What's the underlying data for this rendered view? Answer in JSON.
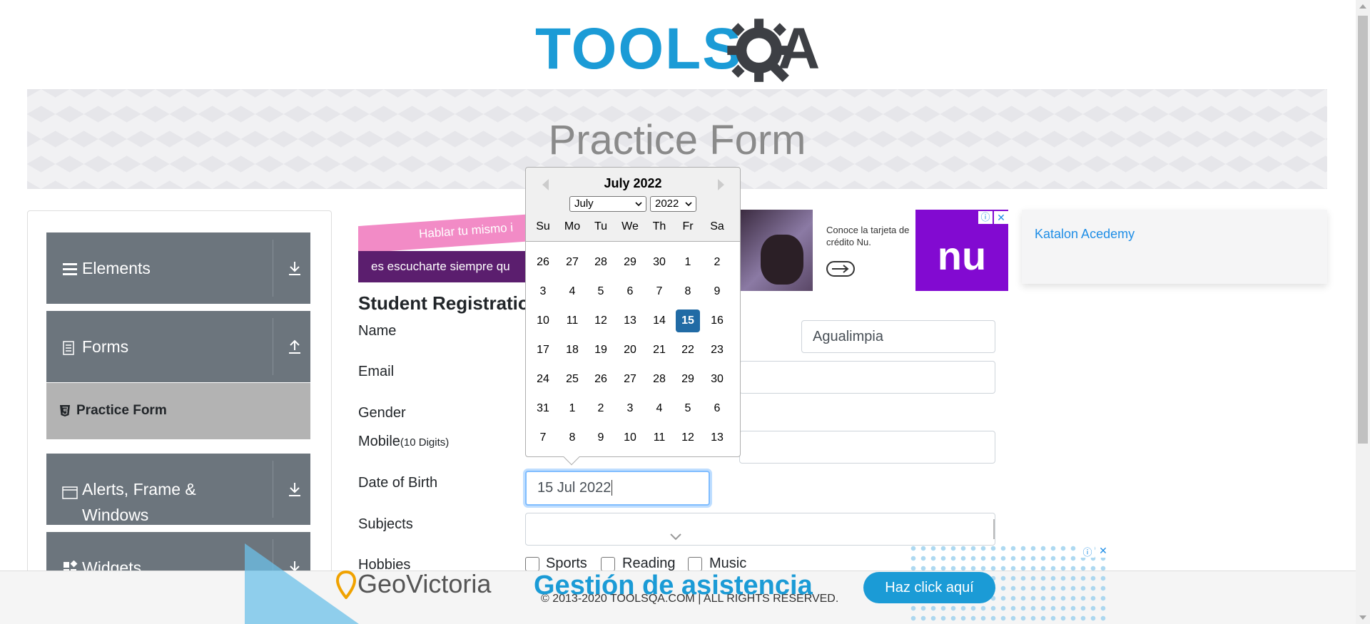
{
  "logo": {
    "text_main": "TOOLS",
    "text_q": "Q",
    "text_a": "A"
  },
  "banner": {
    "title": "Practice Form"
  },
  "sidebar": {
    "groups": [
      {
        "label": "Elements",
        "icon": "hamburger-icon",
        "state": "collapsed"
      },
      {
        "label": "Forms",
        "icon": "document-icon",
        "state": "expanded"
      },
      {
        "label": "Alerts, Frame & Windows",
        "icon": "window-icon",
        "state": "collapsed"
      },
      {
        "label": "Widgets",
        "icon": "widgets-icon",
        "state": "collapsed"
      }
    ],
    "active_item": {
      "label": "Practice Form",
      "icon": "html5-icon"
    }
  },
  "ads": {
    "ad1": {
      "line1": "Hablar tu mismo i",
      "line2": "es escucharte siempre qu"
    },
    "ad2": {
      "copy": "Conoce la tarjeta de crédito Nu.",
      "brand": "nu"
    },
    "ad3": {
      "alt": "Katalon Acedemy"
    }
  },
  "form": {
    "title": "Student Registration",
    "labels": {
      "name": "Name",
      "email": "Email",
      "gender": "Gender",
      "mobile": "Mobile",
      "mobile_hint": "(10 Digits)",
      "dob": "Date of Birth",
      "subjects": "Subjects",
      "hobbies": "Hobbies"
    },
    "last_name_value": "Agualimpia",
    "dob_value": "15 Jul 2022",
    "hobbies": [
      "Sports",
      "Reading",
      "Music"
    ]
  },
  "datepicker": {
    "header": "July 2022",
    "month_select": "July",
    "year_select": "2022",
    "day_names": [
      "Su",
      "Mo",
      "Tu",
      "We",
      "Th",
      "Fr",
      "Sa"
    ],
    "weeks": [
      [
        "26",
        "27",
        "28",
        "29",
        "30",
        "1",
        "2"
      ],
      [
        "3",
        "4",
        "5",
        "6",
        "7",
        "8",
        "9"
      ],
      [
        "10",
        "11",
        "12",
        "13",
        "14",
        "15",
        "16"
      ],
      [
        "17",
        "18",
        "19",
        "20",
        "21",
        "22",
        "23"
      ],
      [
        "24",
        "25",
        "26",
        "27",
        "28",
        "29",
        "30"
      ],
      [
        "31",
        "1",
        "2",
        "3",
        "4",
        "5",
        "6"
      ],
      [
        "7",
        "8",
        "9",
        "10",
        "11",
        "12",
        "13"
      ]
    ],
    "selected": "15"
  },
  "footer": {
    "copyright": "© 2013-2020 TOOLSQA.COM | ALL RIGHTS RESERVED.",
    "ad_brand": "GeoVictoria",
    "ad_headline": "Gestión de asistencia",
    "ad_cta": "Haz click aquí"
  },
  "colors": {
    "accent_blue": "#1b9bd6",
    "sidebar_gray": "#6c757d",
    "selected_day": "#216ba5"
  }
}
